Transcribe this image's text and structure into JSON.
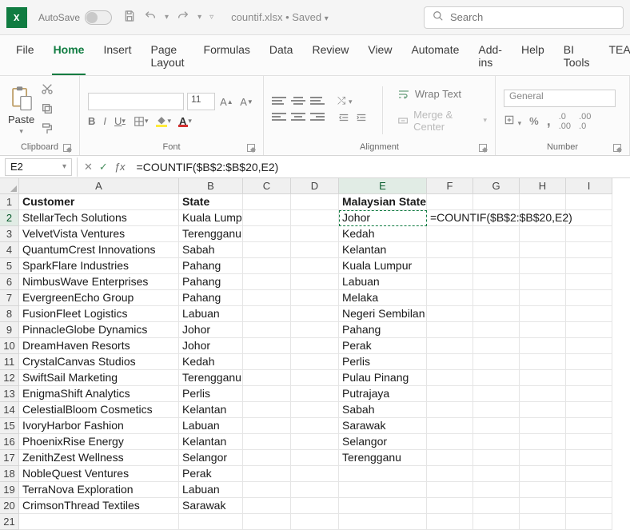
{
  "titlebar": {
    "autosave_label": "AutoSave",
    "doc_name": "countif.xlsx",
    "saved_status": "Saved",
    "search_placeholder": "Search"
  },
  "tabs": [
    "File",
    "Home",
    "Insert",
    "Page Layout",
    "Formulas",
    "Data",
    "Review",
    "View",
    "Automate",
    "Add-ins",
    "Help",
    "BI Tools",
    "TEAM"
  ],
  "active_tab": "Home",
  "ribbon": {
    "clipboard": {
      "paste": "Paste",
      "label": "Clipboard"
    },
    "font": {
      "size": "11",
      "label": "Font",
      "bold": "B",
      "italic": "I",
      "underline": "U"
    },
    "alignment": {
      "wrap": "Wrap Text",
      "merge": "Merge & Center",
      "label": "Alignment"
    },
    "number": {
      "format": "General",
      "label": "Number"
    }
  },
  "namebox": "E2",
  "formula": "=COUNTIF($B$2:$B$20,E2)",
  "columns": [
    "A",
    "B",
    "C",
    "D",
    "E",
    "F",
    "G",
    "H",
    "I"
  ],
  "rows": [
    {
      "n": 1,
      "A": "Customer",
      "B": "State",
      "E": "Malaysian States",
      "bold": true
    },
    {
      "n": 2,
      "A": "StellarTech Solutions",
      "B": "Kuala Lumpur",
      "E": "Johor",
      "F": "=COUNTIF($B$2:$B$20,E2)",
      "sel": "E",
      "overflowF": true
    },
    {
      "n": 3,
      "A": "VelvetVista Ventures",
      "B": "Terengganu",
      "E": "Kedah"
    },
    {
      "n": 4,
      "A": "QuantumCrest Innovations",
      "B": "Sabah",
      "E": "Kelantan"
    },
    {
      "n": 5,
      "A": "SparkFlare Industries",
      "B": "Pahang",
      "E": "Kuala Lumpur"
    },
    {
      "n": 6,
      "A": "NimbusWave Enterprises",
      "B": "Pahang",
      "E": "Labuan"
    },
    {
      "n": 7,
      "A": "EvergreenEcho Group",
      "B": "Pahang",
      "E": "Melaka"
    },
    {
      "n": 8,
      "A": "FusionFleet Logistics",
      "B": "Labuan",
      "E": "Negeri Sembilan"
    },
    {
      "n": 9,
      "A": "PinnacleGlobe Dynamics",
      "B": "Johor",
      "E": "Pahang"
    },
    {
      "n": 10,
      "A": "DreamHaven Resorts",
      "B": "Johor",
      "E": "Perak"
    },
    {
      "n": 11,
      "A": "CrystalCanvas Studios",
      "B": "Kedah",
      "E": "Perlis"
    },
    {
      "n": 12,
      "A": "SwiftSail Marketing",
      "B": "Terengganu",
      "E": "Pulau Pinang"
    },
    {
      "n": 13,
      "A": "EnigmaShift Analytics",
      "B": "Perlis",
      "E": "Putrajaya"
    },
    {
      "n": 14,
      "A": "CelestialBloom Cosmetics",
      "B": "Kelantan",
      "E": "Sabah"
    },
    {
      "n": 15,
      "A": "IvoryHarbor Fashion",
      "B": "Labuan",
      "E": "Sarawak"
    },
    {
      "n": 16,
      "A": "PhoenixRise Energy",
      "B": "Kelantan",
      "E": "Selangor"
    },
    {
      "n": 17,
      "A": "ZenithZest Wellness",
      "B": "Selangor",
      "E": "Terengganu"
    },
    {
      "n": 18,
      "A": "NobleQuest Ventures",
      "B": "Perak"
    },
    {
      "n": 19,
      "A": "TerraNova Exploration",
      "B": "Labuan"
    },
    {
      "n": 20,
      "A": "CrimsonThread Textiles",
      "B": "Sarawak"
    },
    {
      "n": 21
    }
  ]
}
